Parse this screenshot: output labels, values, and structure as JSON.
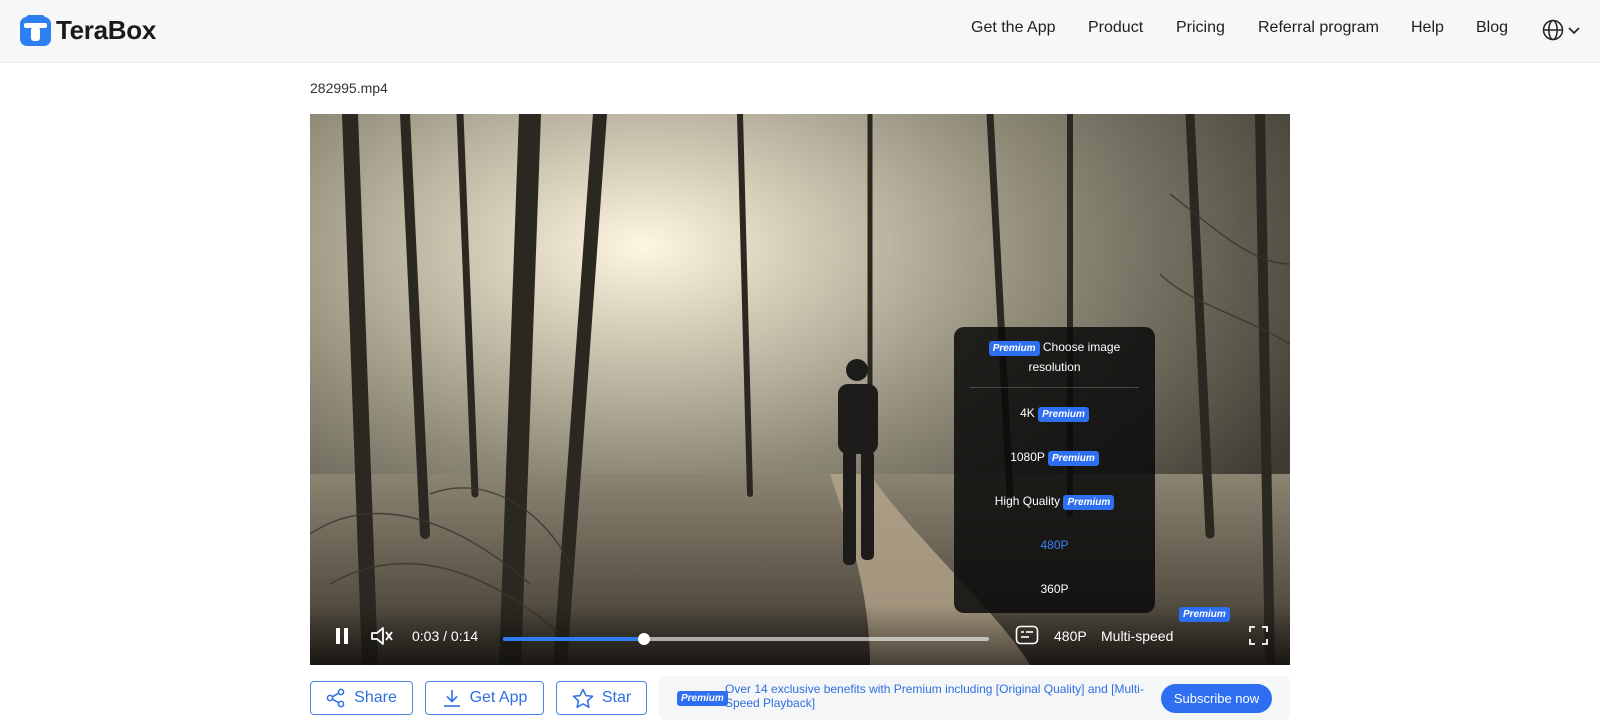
{
  "brand": {
    "name": "TeraBox",
    "color": "#2e7ff1"
  },
  "nav": {
    "items": [
      "Get the App",
      "Product",
      "Pricing",
      "Referral program",
      "Help",
      "Blog"
    ],
    "language_icon": "globe-icon"
  },
  "file": {
    "name": "282995.mp4"
  },
  "player": {
    "time": "0:03 / 0:14",
    "progress_fraction": 0.29,
    "quality": "480P",
    "speed_label": "Multi-speed",
    "premium_badge": "Premium",
    "state": "playing",
    "muted": true
  },
  "resolution_menu": {
    "badge": "Premium",
    "title": "Choose image resolution",
    "options": [
      {
        "label": "4K",
        "premium": true,
        "badge": "Premium"
      },
      {
        "label": "1080P",
        "premium": true,
        "badge": "Premium"
      },
      {
        "label": "High Quality",
        "premium": true,
        "badge": "Premium"
      },
      {
        "label": "480P",
        "selected": true
      },
      {
        "label": "360P"
      }
    ]
  },
  "actions": {
    "share": "Share",
    "get_app": "Get App",
    "star": "Star"
  },
  "promo": {
    "badge": "Premium",
    "text": "Over 14 exclusive benefits with Premium including [Original Quality] and [Multi-Speed Playback]",
    "cta": "Subscribe now"
  },
  "colors": {
    "accent": "#2d6ff0",
    "selected_option": "#3b82f6"
  }
}
